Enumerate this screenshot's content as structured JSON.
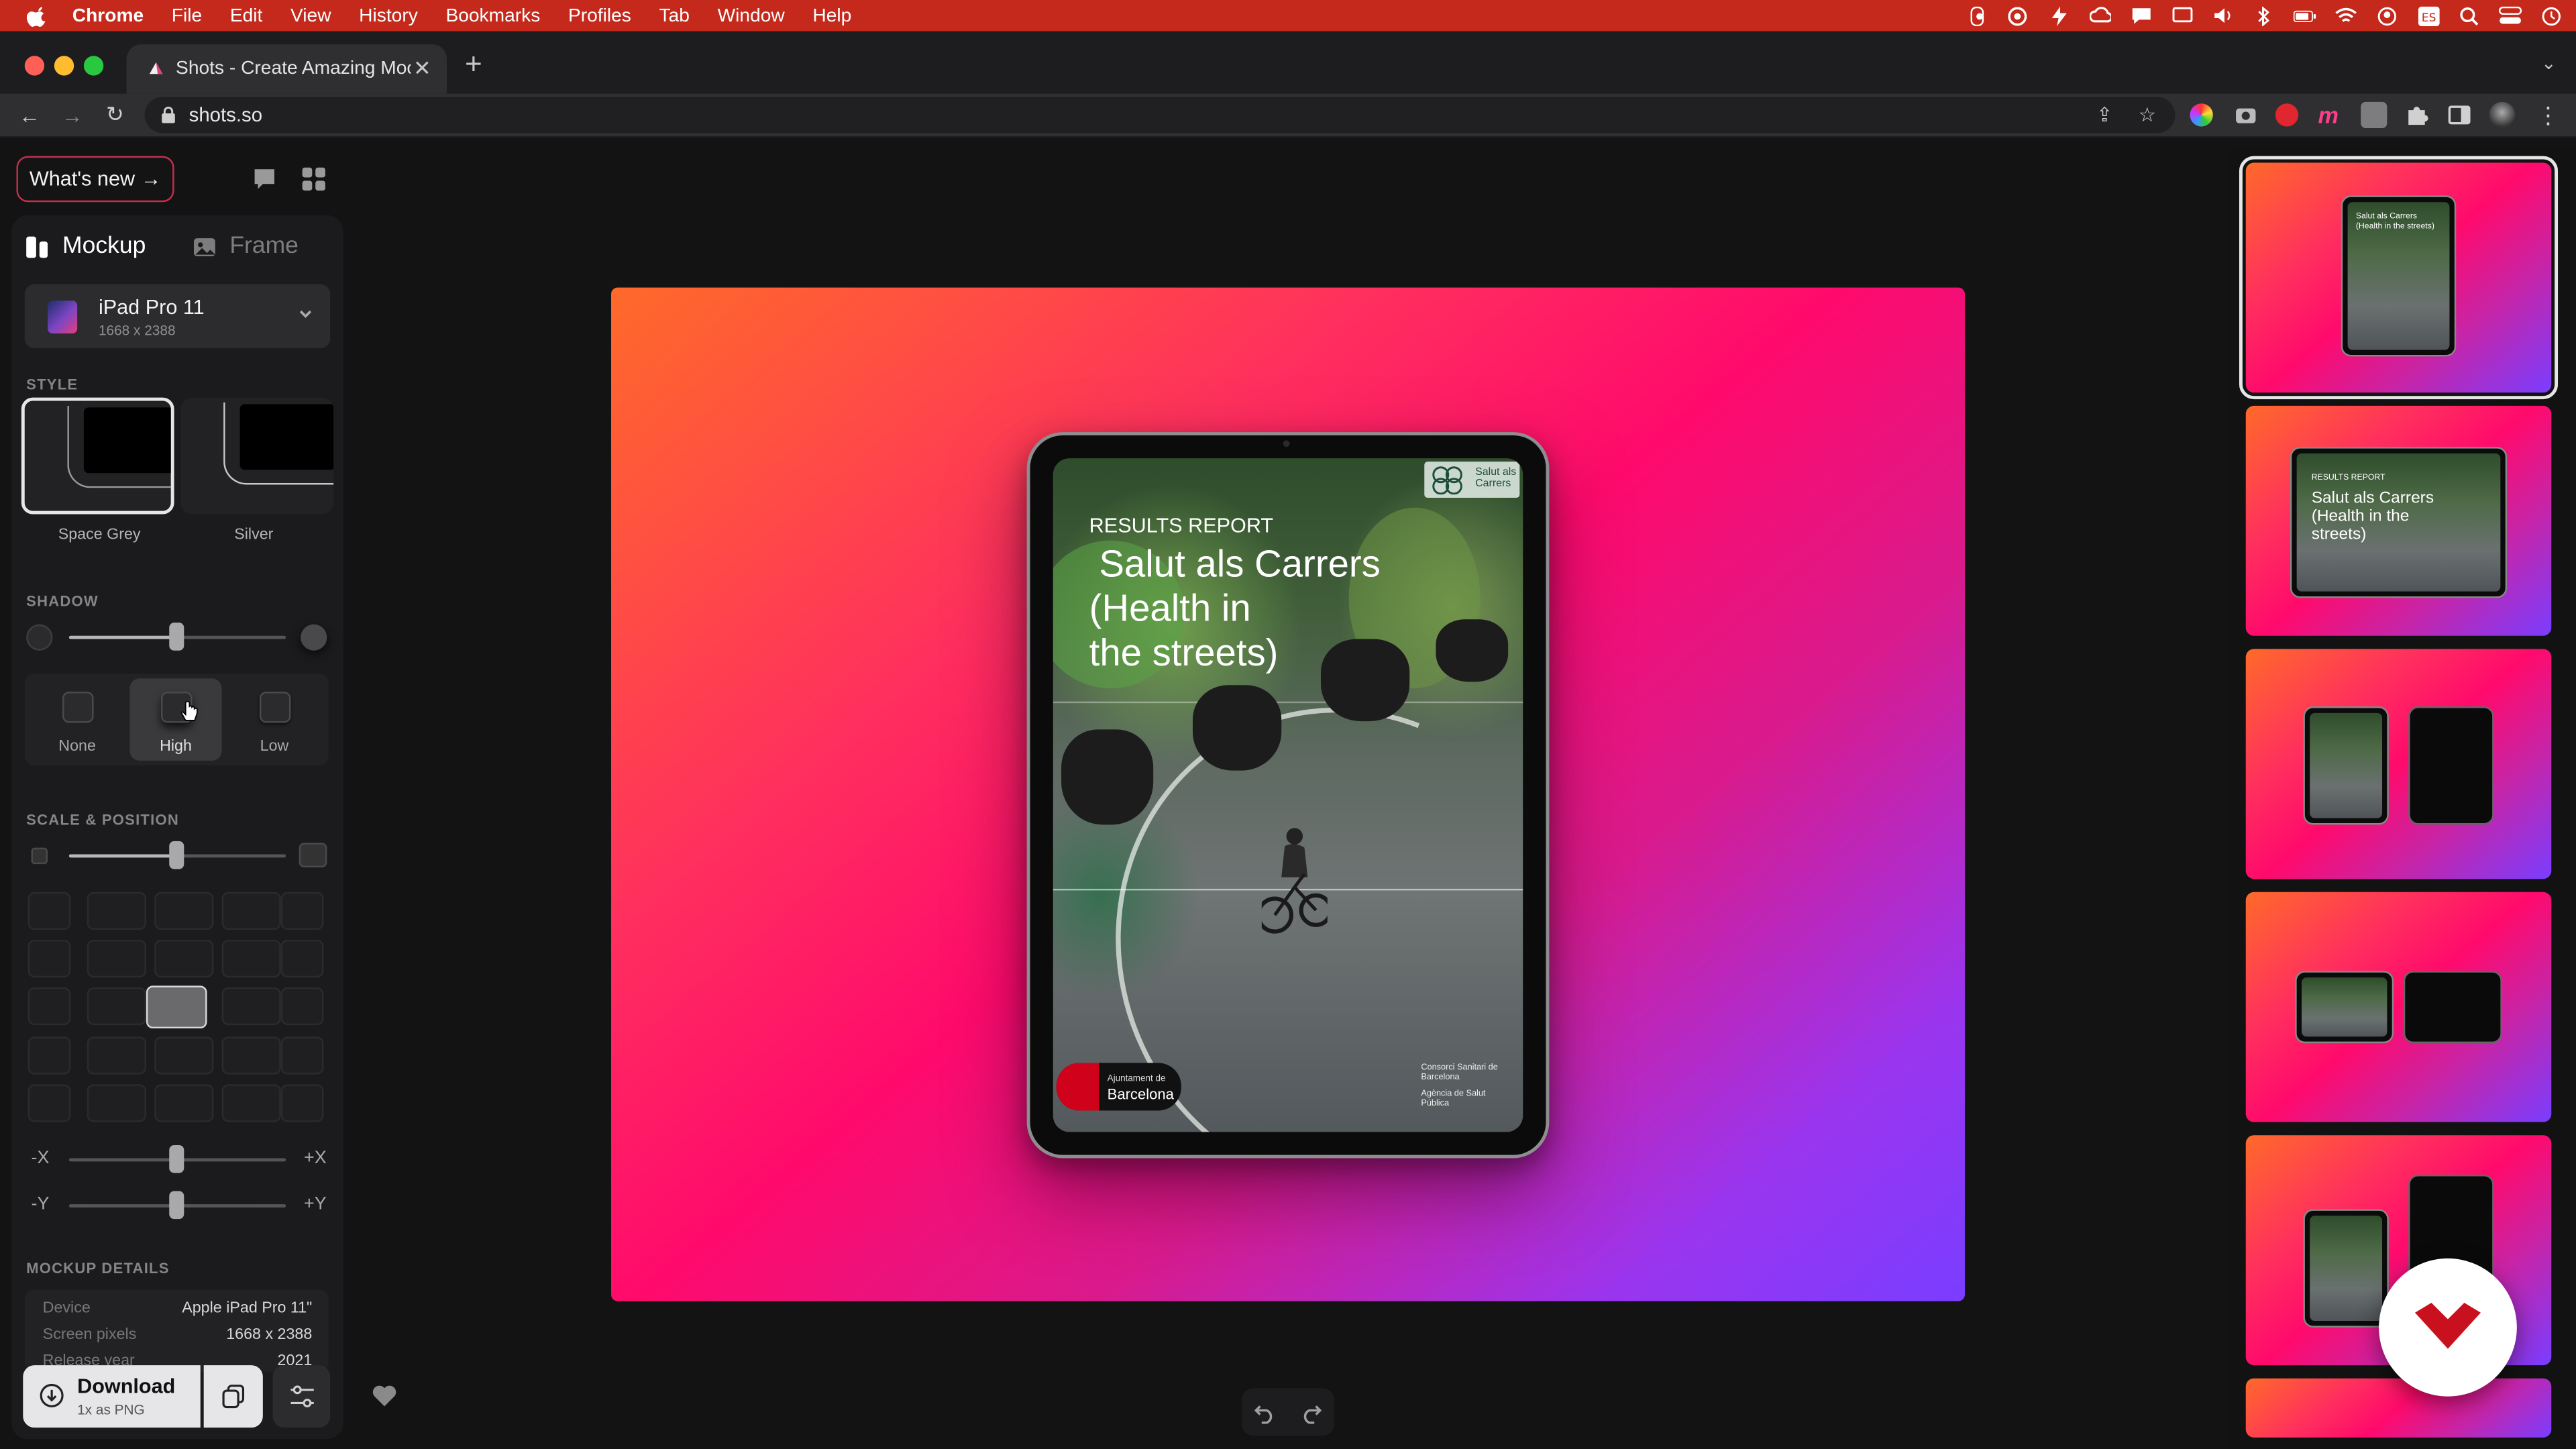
{
  "menubar": {
    "app": "Chrome",
    "items": [
      "File",
      "Edit",
      "View",
      "History",
      "Bookmarks",
      "Profiles",
      "Tab",
      "Window",
      "Help"
    ]
  },
  "browser": {
    "tab_title": "Shots - Create Amazing Mocku",
    "url": "shots.so"
  },
  "app": {
    "whats_new": "What's new →",
    "tabs": {
      "mockup": "Mockup",
      "frame": "Frame"
    },
    "device": {
      "name": "iPad Pro 11",
      "size": "1668 x 2388"
    },
    "style": {
      "heading": "STYLE",
      "options": [
        {
          "label": "Space Grey",
          "selected": true
        },
        {
          "label": "Silver",
          "selected": false
        }
      ]
    },
    "shadow": {
      "heading": "SHADOW",
      "level": 0.49,
      "options": [
        {
          "label": "None",
          "selected": false
        },
        {
          "label": "High",
          "selected": true
        },
        {
          "label": "Low",
          "selected": false
        }
      ]
    },
    "scale_position": {
      "heading": "SCALE & POSITION",
      "scale": 0.49,
      "grid_selected": "row 3, column 3",
      "x_axis": {
        "min": "-X",
        "max": "+X",
        "value": 0.5
      },
      "y_axis": {
        "min": "-Y",
        "max": "+Y",
        "value": 0.5
      }
    },
    "details": {
      "heading": "MOCKUP DETAILS",
      "rows": [
        {
          "key": "Device",
          "value": "Apple iPad Pro 11\""
        },
        {
          "key": "Screen pixels",
          "value": "1668 x 2388"
        },
        {
          "key": "Release year",
          "value": "2021"
        }
      ]
    },
    "download": {
      "label": "Download",
      "sub": "1x as PNG"
    }
  },
  "screen_content": {
    "kicker": "RESULTS REPORT",
    "title_l1": "Salut als Carrers",
    "title_l2": "(Health in",
    "title_l3": "the streets)",
    "logo_tr": "Salut als Carrers",
    "logo_bl_small": "Ajuntament de",
    "logo_bl_big": "Barcelona",
    "logo_br_1": "Consorci Sanitari de Barcelona",
    "logo_br_2": "Agència de Salut Pública"
  },
  "thumbnail_text": {
    "kicker": "RESULTS REPORT",
    "title": "Salut als Carrers (Health in the streets)"
  },
  "colors": {
    "menubar": "#c4291c",
    "accent": "#c2304d",
    "gradient": [
      "#ff6a2a",
      "#ff0a6c",
      "#7a3dff"
    ]
  }
}
